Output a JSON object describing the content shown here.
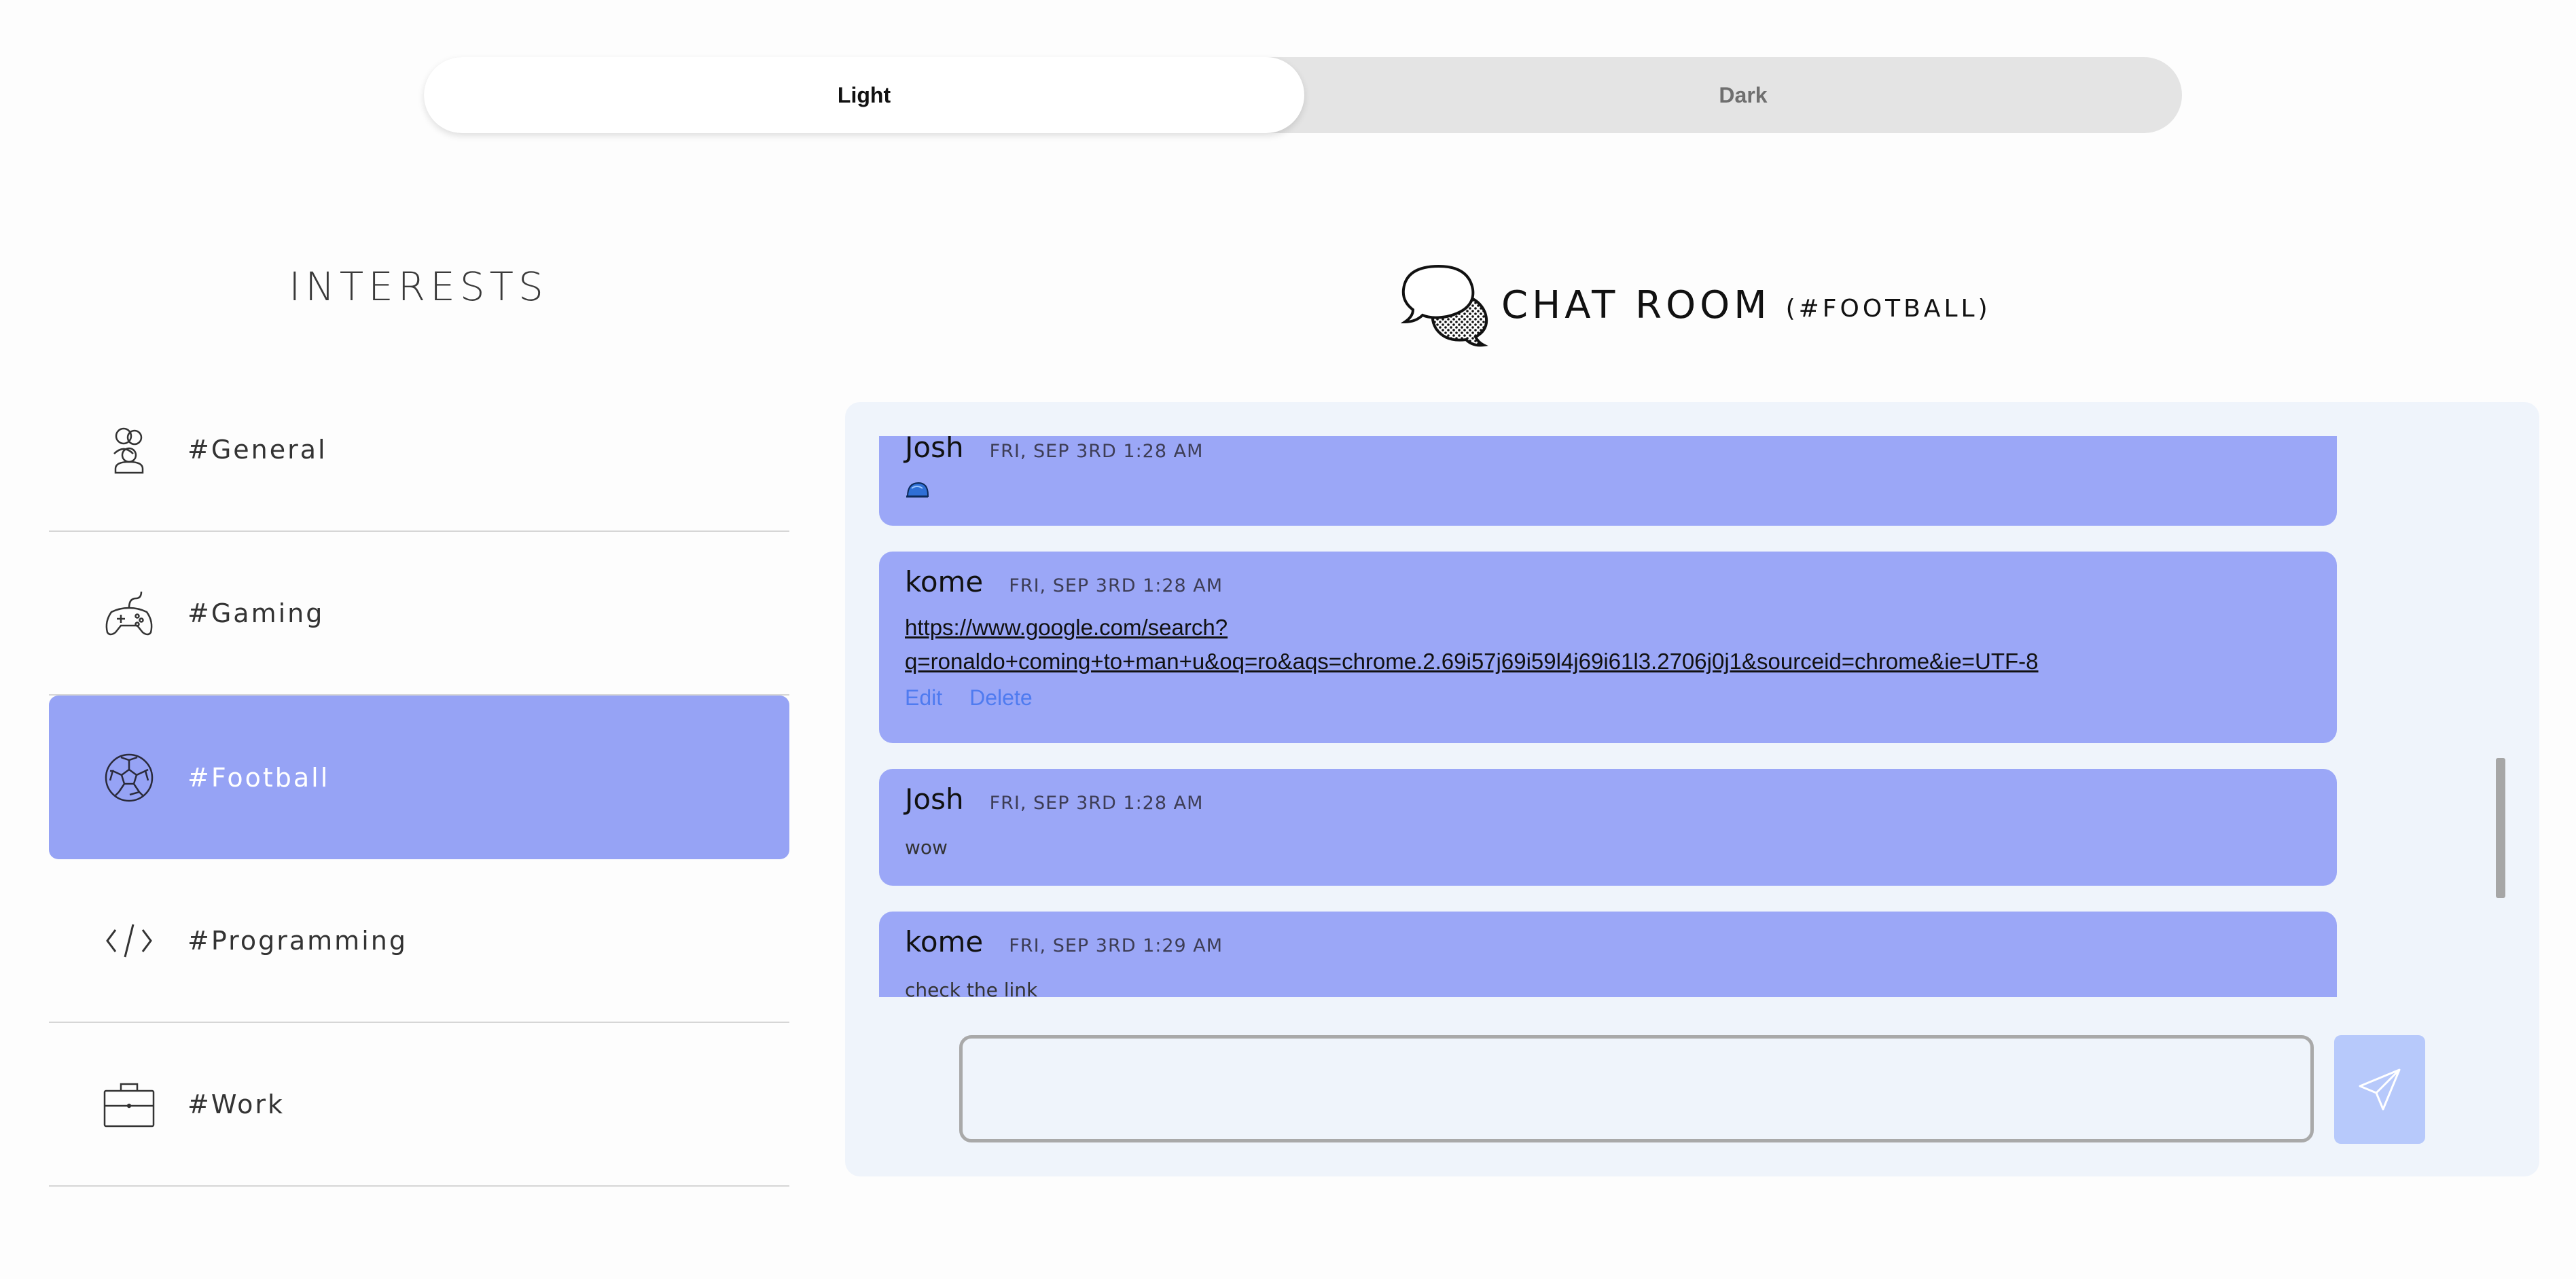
{
  "theme_toggle": {
    "light_label": "Light",
    "dark_label": "Dark",
    "selected": "Light"
  },
  "interests": {
    "title": "INTERESTS",
    "items": [
      {
        "label": "#General",
        "icon": "people-icon",
        "active": false
      },
      {
        "label": "#Gaming",
        "icon": "gamepad-icon",
        "active": false
      },
      {
        "label": "#Football",
        "icon": "soccer-ball-icon",
        "active": true
      },
      {
        "label": "#Programming",
        "icon": "code-icon",
        "active": false
      },
      {
        "label": "#Work",
        "icon": "briefcase-icon",
        "active": false
      }
    ]
  },
  "chat": {
    "title": "CHAT ROOM",
    "subtitle": "(#FOOTBALL)",
    "messages": [
      {
        "author": "Josh",
        "time": "FRI, SEP 3RD 1:28 AM",
        "emoji": "cap-emoji-icon"
      },
      {
        "author": "kome",
        "time": "FRI, SEP 3RD 1:28 AM",
        "link_line1": "https://www.google.com/search?",
        "link_line2": "q=ronaldo+coming+to+man+u&oq=ro&aqs=chrome.2.69i57j69i59l4j69i61l3.2706j0j1&sourceid=chrome&ie=UTF-8",
        "edit_label": "Edit",
        "delete_label": "Delete"
      },
      {
        "author": "Josh",
        "time": "FRI, SEP 3RD 1:28 AM",
        "text": "wow"
      },
      {
        "author": "kome",
        "time": "FRI, SEP 3RD 1:29 AM",
        "text": "check the link"
      }
    ],
    "input": {
      "value": "",
      "placeholder": ""
    },
    "send_icon": "paper-plane-icon"
  },
  "colors": {
    "accent": "#96a3f5",
    "message_bg": "#9ba7f7",
    "panel_bg": "#eff4fb",
    "link_action": "#4f7bf0",
    "send_button": "#b7c9fb"
  }
}
